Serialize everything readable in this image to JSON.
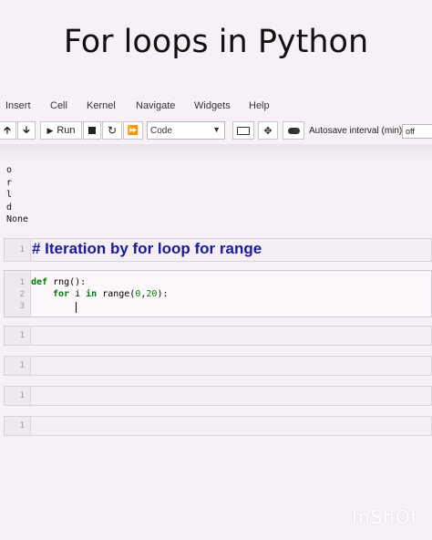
{
  "title": "For loops in Python",
  "menu": [
    "Insert",
    "Cell",
    "Kernel",
    "Navigate",
    "Widgets",
    "Help"
  ],
  "toolbar": {
    "run_label": "Run",
    "cell_type": "Code",
    "autosave_label": "Autosave interval (min):",
    "autosave_value": "off"
  },
  "output_lines": [
    "o",
    "r",
    "l",
    "d",
    "None"
  ],
  "cells": {
    "markdown": {
      "line": "1",
      "text": "# Iteration by for loop for range"
    },
    "code": {
      "lines": [
        "1",
        "2",
        "3"
      ],
      "line1_kw": "def",
      "line1_rest": " rng():",
      "line2_kw1": "for",
      "line2_var": " i ",
      "line2_kw2": "in",
      "line2_call": " range(",
      "line2_a": "0",
      "line2_comma": ",",
      "line2_b": "20",
      "line2_end": "):"
    },
    "empty_line": "1"
  },
  "watermark": "InShOt"
}
